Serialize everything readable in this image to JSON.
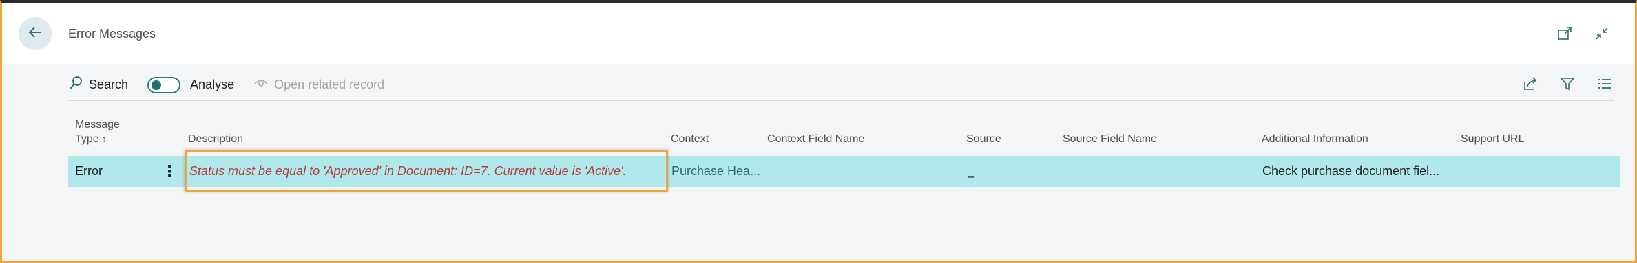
{
  "page": {
    "title": "Error Messages"
  },
  "actions": {
    "search_label": "Search",
    "analyse_label": "Analyse",
    "analyse_on": false,
    "open_related_label": "Open related record"
  },
  "grid": {
    "headers": {
      "message_type_line1": "Message",
      "message_type_line2": "Type",
      "message_type_sort": "↑",
      "description": "Description",
      "context": "Context",
      "context_field_name": "Context Field Name",
      "source": "Source",
      "source_field_name": "Source Field Name",
      "additional_information": "Additional Information",
      "support_url": "Support URL"
    },
    "rows": [
      {
        "message_type": "Error",
        "description": "Status must be equal to 'Approved'  in Document: ID=7. Current value is 'Active'.",
        "context": "Purchase Hea...",
        "context_field_name": "",
        "source": "_",
        "source_field_name": "",
        "additional_information": "Check purchase document fiel...",
        "support_url": ""
      }
    ]
  },
  "icons": {
    "back": "back-arrow-icon",
    "open_new_window": "open-new-window-icon",
    "collapse": "collapse-icon",
    "search": "search-icon",
    "open_related": "eye-icon",
    "share": "share-icon",
    "filter": "filter-icon",
    "list_options": "list-options-icon",
    "row_menu": "more-vertical-icon"
  },
  "colors": {
    "accent_border": "#f2a33a",
    "row_highlight": "#b0e8eb",
    "error_text": "#b23b3b",
    "teal": "#1f6f6f"
  }
}
